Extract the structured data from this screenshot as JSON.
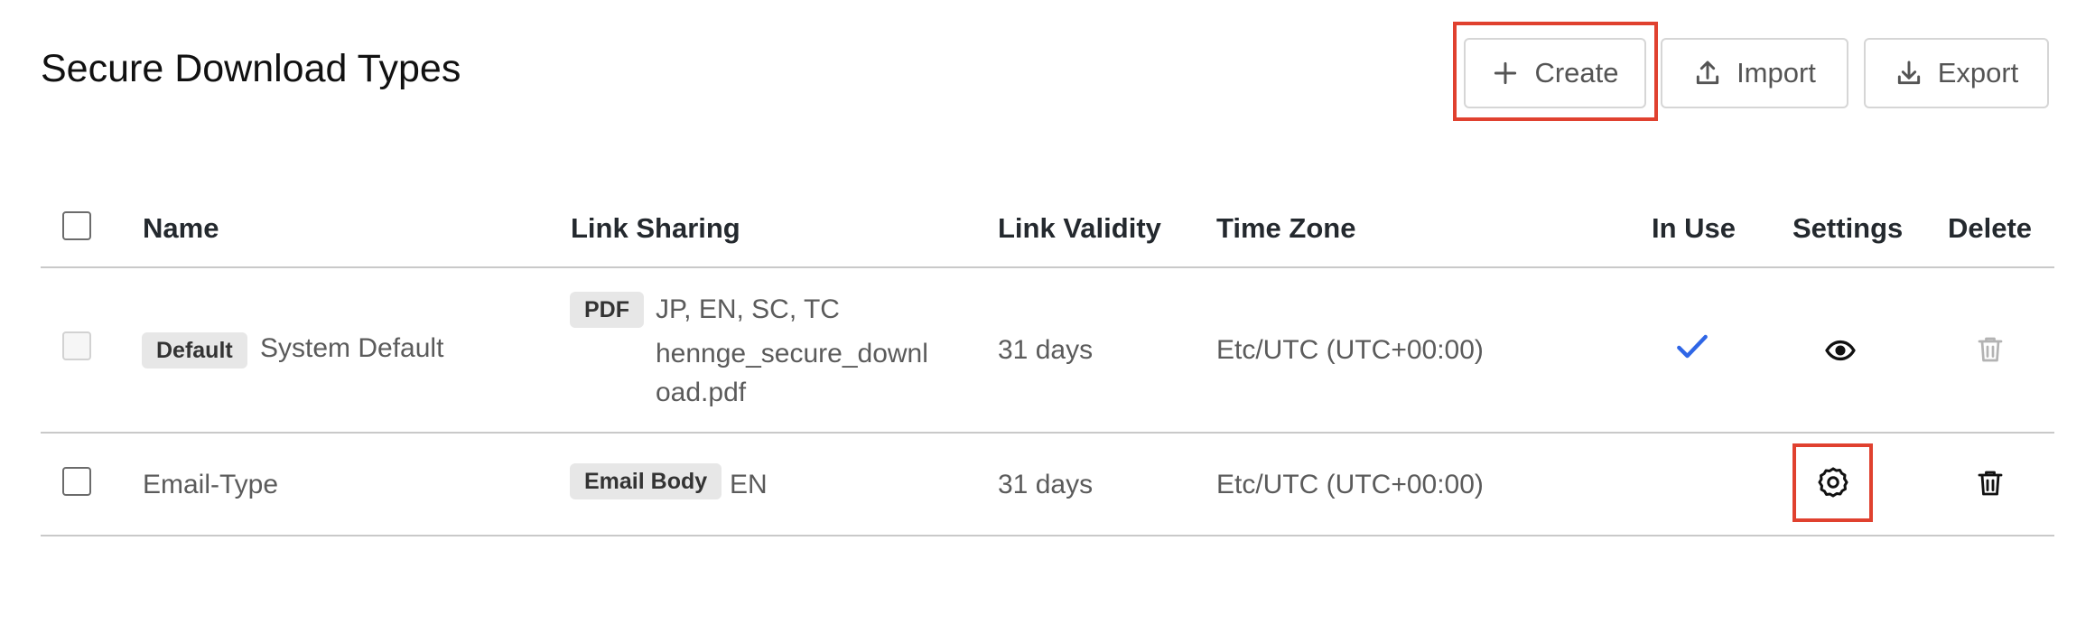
{
  "page": {
    "title": "Secure Download Types"
  },
  "toolbar": {
    "create_label": "Create",
    "import_label": "Import",
    "export_label": "Export"
  },
  "table": {
    "columns": {
      "name": "Name",
      "link_sharing": "Link Sharing",
      "link_validity": "Link Validity",
      "time_zone": "Time Zone",
      "in_use": "In Use",
      "settings": "Settings",
      "delete": "Delete"
    },
    "rows": [
      {
        "badge": "Default",
        "name": "System Default",
        "link_tag": "PDF",
        "languages": "JP, EN, SC, TC",
        "file_line1": "hennge_secure_downl",
        "file_line2": "oad.pdf",
        "validity": "31 days",
        "time_zone": "Etc/UTC (UTC+00:00)",
        "in_use": true,
        "settings_icon": "eye-icon",
        "selectable": false
      },
      {
        "name": "Email-Type",
        "link_tag": "Email Body",
        "languages": "EN",
        "validity": "31 days",
        "time_zone": "Etc/UTC (UTC+00:00)",
        "in_use": false,
        "settings_icon": "gear-icon",
        "selectable": true
      }
    ]
  },
  "colors": {
    "highlight": "#e0412f",
    "check": "#2f66e6",
    "tag_bg": "#e7e7e7"
  }
}
